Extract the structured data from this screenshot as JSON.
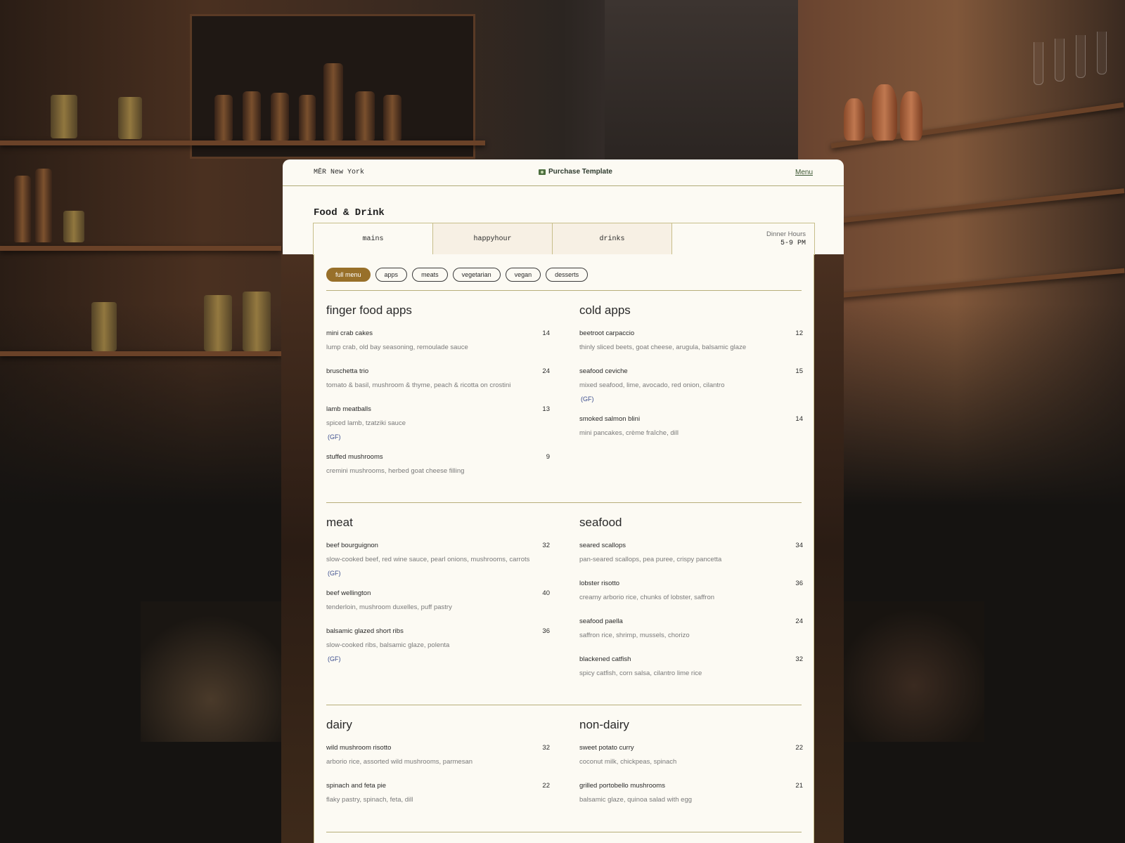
{
  "header": {
    "brand": "MĒR New York",
    "purchase_label": "Purchase Template",
    "menu_label": "Menu"
  },
  "page": {
    "title": "Food & Drink",
    "tabs": [
      {
        "label": "mains",
        "active": true
      },
      {
        "label": "happyhour",
        "active": false
      },
      {
        "label": "drinks",
        "active": false
      }
    ],
    "hours_label": "Dinner Hours",
    "hours_time": "5-9 PM"
  },
  "filters": [
    "full menu",
    "apps",
    "meats",
    "vegetarian",
    "vegan",
    "desserts"
  ],
  "sections": {
    "finger_food": {
      "title": "finger food apps",
      "items": [
        {
          "name": "mini crab cakes",
          "price": "14",
          "desc": "lump crab, old bay seasoning, remoulade sauce"
        },
        {
          "name": "bruschetta trio",
          "price": "24",
          "desc": "tomato & basil, mushroom & thyme, peach & ricotta on crostini"
        },
        {
          "name": "lamb meatballs",
          "price": "13",
          "desc": "spiced lamb, tzatziki sauce",
          "tag": "(GF)"
        },
        {
          "name": "stuffed mushrooms",
          "price": "9",
          "desc": "cremini mushrooms, herbed goat cheese filling"
        }
      ]
    },
    "cold_apps": {
      "title": "cold apps",
      "items": [
        {
          "name": "beetroot carpaccio",
          "price": "12",
          "desc": "thinly sliced beets, goat cheese, arugula, balsamic glaze"
        },
        {
          "name": "seafood ceviche",
          "price": "15",
          "desc": "mixed seafood, lime, avocado, red onion, cilantro",
          "tag": "(GF)"
        },
        {
          "name": "smoked salmon blini",
          "price": "14",
          "desc": "mini pancakes, crème fraîche, dill"
        }
      ]
    },
    "meat": {
      "title": "meat",
      "items": [
        {
          "name": "beef bourguignon",
          "price": "32",
          "desc": "slow-cooked beef, red wine sauce, pearl onions, mushrooms, carrots",
          "tag": "(GF)"
        },
        {
          "name": "beef wellington",
          "price": "40",
          "desc": "tenderloin, mushroom duxelles, puff pastry"
        },
        {
          "name": "balsamic glazed short ribs",
          "price": "36",
          "desc": "slow-cooked ribs, balsamic glaze, polenta",
          "tag": "(GF)"
        }
      ]
    },
    "seafood": {
      "title": "seafood",
      "items": [
        {
          "name": "seared scallops",
          "price": "34",
          "desc": "pan-seared scallops, pea puree, crispy pancetta"
        },
        {
          "name": "lobster risotto",
          "price": "36",
          "desc": "creamy arborio rice, chunks of lobster, saffron"
        },
        {
          "name": "seafood paella",
          "price": "24",
          "desc": "saffron rice, shrimp, mussels, chorizo"
        },
        {
          "name": "blackened catfish",
          "price": "32",
          "desc": "spicy catfish, corn salsa, cilantro lime rice"
        }
      ]
    },
    "dairy": {
      "title": "dairy",
      "items": [
        {
          "name": "wild mushroom risotto",
          "price": "32",
          "desc": "arborio rice, assorted wild mushrooms, parmesan"
        },
        {
          "name": "spinach and feta pie",
          "price": "22",
          "desc": "flaky pastry, spinach, feta, dill"
        }
      ]
    },
    "non_dairy": {
      "title": "non-dairy",
      "items": [
        {
          "name": "sweet potato curry",
          "price": "22",
          "desc": "coconut milk, chickpeas, spinach"
        },
        {
          "name": "grilled portobello mushrooms",
          "price": "21",
          "desc": "balsamic glaze, quinoa salad with egg"
        }
      ]
    }
  },
  "colors": {
    "accent": "#98702a",
    "card_bg": "#fcfaf3",
    "rule": "#b7ae7a",
    "gf_tag": "#3c4e8e",
    "purchase_icon": "#4d6f3f"
  }
}
